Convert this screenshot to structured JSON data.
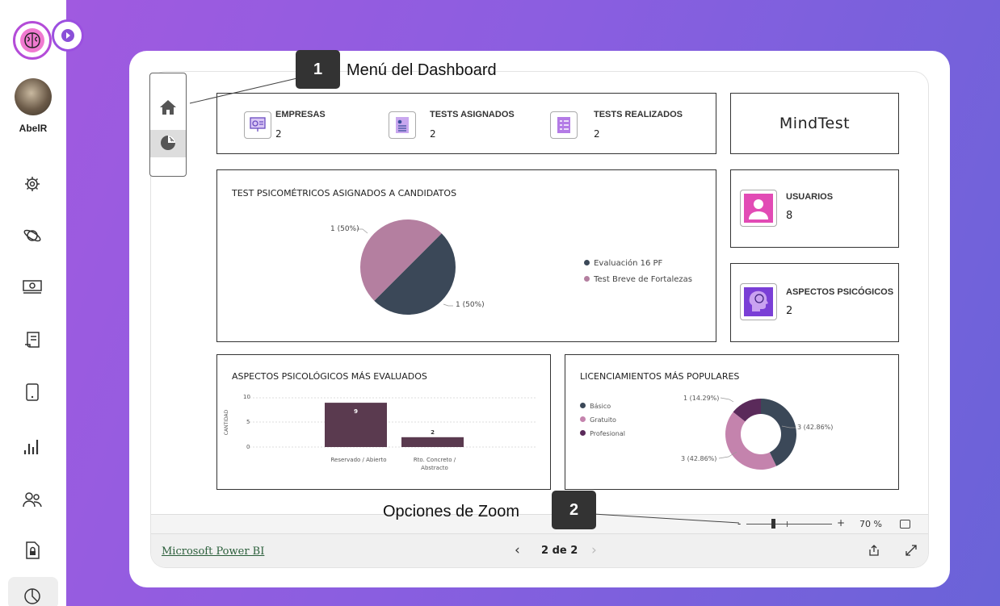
{
  "sidebar": {
    "user_name": "AbelR",
    "icons": [
      "gear-icon",
      "planet-icon",
      "money-icon",
      "receipt-icon",
      "tablet-icon",
      "bar-chart-icon",
      "users-icon",
      "document-lock-icon",
      "pie-chart-icon"
    ]
  },
  "callouts": {
    "one": {
      "number": "1",
      "text": "Menú del Dashboard"
    },
    "two": {
      "number": "2",
      "text": "Opciones de Zoom"
    }
  },
  "kpis": {
    "empresas": {
      "label": "EMPRESAS",
      "value": "2"
    },
    "tests_asignados": {
      "label": "TESTS ASIGNADOS",
      "value": "2"
    },
    "tests_realizados": {
      "label": "TESTS REALIZADOS",
      "value": "2"
    },
    "usuarios": {
      "label": "USUARIOS",
      "value": "8"
    },
    "aspectos": {
      "label": "ASPECTOS PSICÓGICOS",
      "value": "2"
    }
  },
  "brand": "MindTest",
  "pie_chart": {
    "title": "TEST PSICOMÉTRICOS ASIGNADOS A CANDIDATOS",
    "label_top": "1 (50%)",
    "label_bottom": "1 (50%)",
    "legend": [
      "Evaluación 16 PF",
      "Test Breve de Fortalezas"
    ],
    "colors": [
      "#3b4858",
      "#b47fa0"
    ]
  },
  "chart_data": [
    {
      "type": "pie",
      "title": "TEST PSICOMÉTRICOS ASIGNADOS A CANDIDATOS",
      "series": [
        {
          "name": "Evaluación 16 PF",
          "value": 1
        },
        {
          "name": "Test Breve de Fortalezas",
          "value": 1
        }
      ]
    },
    {
      "type": "bar",
      "title": "ASPECTOS  PSICOLÓGICOS MÁS EVALUADOS",
      "ylabel": "CANTIDAD",
      "categories": [
        "Reservado / Abierto",
        "Rto. Concreto / Abstracto"
      ],
      "values": [
        9,
        2
      ],
      "ylim": [
        0,
        10
      ],
      "yticks": [
        "10",
        "5",
        "0"
      ]
    },
    {
      "type": "pie",
      "subtype": "donut",
      "title": "LICENCIAMIENTOS MÁS POPULARES",
      "series": [
        {
          "name": "Básico",
          "value": 3,
          "label": "3 (42.86%)"
        },
        {
          "name": "Gratuito",
          "value": 3,
          "label": "3 (42.86%)"
        },
        {
          "name": "Profesional",
          "value": 1,
          "label": "1 (14.29%)"
        }
      ]
    }
  ],
  "bar_chart": {
    "title": "ASPECTOS  PSICOLÓGICOS MÁS EVALUADOS",
    "ylabel": "CANTIDAD",
    "yticks": [
      "10",
      "5",
      "0"
    ],
    "bars": [
      {
        "cat_line1": "Reservado / Abierto",
        "cat_line2": "",
        "value": "9"
      },
      {
        "cat_line1": "Rto. Concreto /",
        "cat_line2": "Abstracto",
        "value": "2"
      }
    ],
    "color": "#5a3a4f"
  },
  "donut_chart": {
    "title": "LICENCIAMIENTOS MÁS POPULARES",
    "legend": [
      "Básico",
      "Gratuito",
      "Profesional"
    ],
    "colors": [
      "#3b4858",
      "#c483ad",
      "#5a2a5a"
    ],
    "labels": {
      "profesional": "1 (14.29%)",
      "basico": "3 (42.86%)",
      "gratuito": "3 (42.86%)"
    }
  },
  "zoom": {
    "minus": "-",
    "plus": "+",
    "level": "70 %"
  },
  "footer": {
    "link": "Microsoft Power BI",
    "page": "2 de 2",
    "prev": "‹",
    "next": "›"
  }
}
